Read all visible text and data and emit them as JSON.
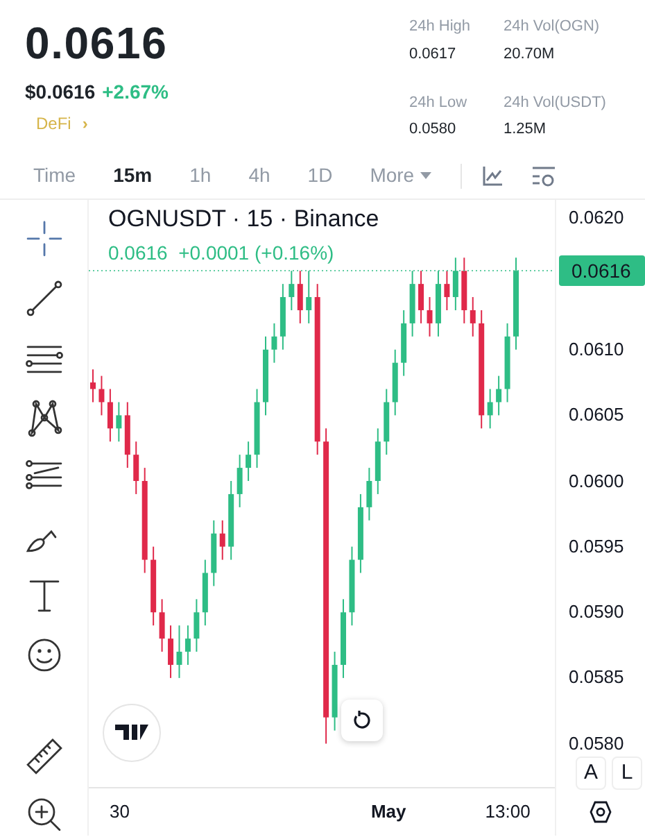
{
  "header": {
    "price": "0.0616",
    "fiat_price": "$0.0616",
    "change": "+2.67%",
    "tag": "DeFi",
    "tag_arrow": "›"
  },
  "stats": [
    {
      "label": "24h High",
      "value": "0.0617"
    },
    {
      "label": "24h Vol(OGN)",
      "value": "20.70M"
    },
    {
      "label": "24h Low",
      "value": "0.0580"
    },
    {
      "label": "24h Vol(USDT)",
      "value": "1.25M"
    }
  ],
  "intervals": [
    {
      "label": "Time",
      "selected": false
    },
    {
      "label": "15m",
      "selected": true
    },
    {
      "label": "1h",
      "selected": false
    },
    {
      "label": "4h",
      "selected": false
    },
    {
      "label": "1D",
      "selected": false
    },
    {
      "label": "More",
      "selected": false,
      "kind": "dropdown"
    }
  ],
  "chart": {
    "title": "OGNUSDT · 15 · Binance",
    "readout": "0.0616  +0.0001 (+0.16%)",
    "last_price": "0.0616",
    "time_ticks": [
      "30",
      "May",
      "13:00"
    ],
    "scale_buttons": [
      "A",
      "L"
    ],
    "chart_data": {
      "type": "candlestick",
      "ylim": [
        0.0573,
        0.06214
      ],
      "yticks": [
        {
          "value": 0.062,
          "label": "0.0620"
        },
        {
          "value": 0.061,
          "label": "0.0610"
        },
        {
          "value": 0.0605,
          "label": "0.0605"
        },
        {
          "value": 0.06,
          "label": "0.0600"
        },
        {
          "value": 0.0595,
          "label": "0.0595"
        },
        {
          "value": 0.059,
          "label": "0.0590"
        },
        {
          "value": 0.0585,
          "label": "0.0585"
        },
        {
          "value": 0.058,
          "label": "0.0580"
        }
      ],
      "categories": [
        null,
        null,
        null,
        null,
        null,
        null,
        null,
        null,
        null,
        null,
        null,
        null,
        null,
        null,
        null,
        null,
        null,
        null,
        null,
        null,
        null,
        null,
        null,
        null,
        null,
        null,
        null,
        null,
        null,
        null,
        null,
        null,
        null,
        null,
        null,
        null,
        null,
        null,
        null,
        null,
        null,
        null,
        null,
        null,
        null,
        null,
        null,
        null,
        null,
        null
      ],
      "ohlc": [
        [
          0.06075,
          0.06085,
          0.0606,
          0.0607
        ],
        [
          0.0607,
          0.0608,
          0.0605,
          0.0606
        ],
        [
          0.0606,
          0.0607,
          0.0603,
          0.0604
        ],
        [
          0.0604,
          0.0606,
          0.0603,
          0.0605
        ],
        [
          0.0605,
          0.0606,
          0.0601,
          0.0602
        ],
        [
          0.0602,
          0.0603,
          0.0599,
          0.06
        ],
        [
          0.06,
          0.0601,
          0.0593,
          0.0594
        ],
        [
          0.0594,
          0.0595,
          0.0589,
          0.059
        ],
        [
          0.059,
          0.0591,
          0.0587,
          0.0588
        ],
        [
          0.0588,
          0.0589,
          0.0585,
          0.0586
        ],
        [
          0.0586,
          0.0589,
          0.0585,
          0.0587
        ],
        [
          0.0587,
          0.0589,
          0.0586,
          0.0588
        ],
        [
          0.0588,
          0.0591,
          0.0587,
          0.059
        ],
        [
          0.059,
          0.0594,
          0.0589,
          0.0593
        ],
        [
          0.0593,
          0.0597,
          0.0592,
          0.0596
        ],
        [
          0.0596,
          0.0597,
          0.0594,
          0.0595
        ],
        [
          0.0595,
          0.06,
          0.0594,
          0.0599
        ],
        [
          0.0599,
          0.0602,
          0.0598,
          0.0601
        ],
        [
          0.0601,
          0.0603,
          0.06,
          0.0602
        ],
        [
          0.0602,
          0.0607,
          0.0601,
          0.0606
        ],
        [
          0.0606,
          0.0611,
          0.0605,
          0.061
        ],
        [
          0.061,
          0.0612,
          0.0609,
          0.0611
        ],
        [
          0.0611,
          0.0615,
          0.061,
          0.0614
        ],
        [
          0.0614,
          0.0616,
          0.0613,
          0.0615
        ],
        [
          0.0615,
          0.0616,
          0.0612,
          0.0613
        ],
        [
          0.0613,
          0.0616,
          0.0612,
          0.0614
        ],
        [
          0.0614,
          0.0615,
          0.0602,
          0.0603
        ],
        [
          0.0603,
          0.0604,
          0.058,
          0.0582
        ],
        [
          0.0582,
          0.0587,
          0.0581,
          0.0586
        ],
        [
          0.0586,
          0.0591,
          0.0585,
          0.059
        ],
        [
          0.059,
          0.0595,
          0.0589,
          0.0594
        ],
        [
          0.0594,
          0.0599,
          0.0593,
          0.0598
        ],
        [
          0.0598,
          0.0601,
          0.0597,
          0.06
        ],
        [
          0.06,
          0.0604,
          0.0599,
          0.0603
        ],
        [
          0.0603,
          0.0607,
          0.0602,
          0.0606
        ],
        [
          0.0606,
          0.061,
          0.0605,
          0.0609
        ],
        [
          0.0609,
          0.0613,
          0.0608,
          0.0612
        ],
        [
          0.0612,
          0.0616,
          0.0611,
          0.0615
        ],
        [
          0.0615,
          0.0616,
          0.0612,
          0.0613
        ],
        [
          0.0613,
          0.0614,
          0.0611,
          0.0612
        ],
        [
          0.0612,
          0.0616,
          0.0611,
          0.0615
        ],
        [
          0.0615,
          0.0616,
          0.0613,
          0.0614
        ],
        [
          0.0614,
          0.0617,
          0.0613,
          0.0616
        ],
        [
          0.0616,
          0.0617,
          0.0612,
          0.0613
        ],
        [
          0.0613,
          0.0614,
          0.0611,
          0.0612
        ],
        [
          0.0612,
          0.0613,
          0.0604,
          0.0605
        ],
        [
          0.0605,
          0.0607,
          0.0604,
          0.0606
        ],
        [
          0.0606,
          0.0608,
          0.0605,
          0.0607
        ],
        [
          0.0607,
          0.0612,
          0.0606,
          0.0611
        ],
        [
          0.0611,
          0.0617,
          0.061,
          0.0616
        ]
      ]
    }
  }
}
